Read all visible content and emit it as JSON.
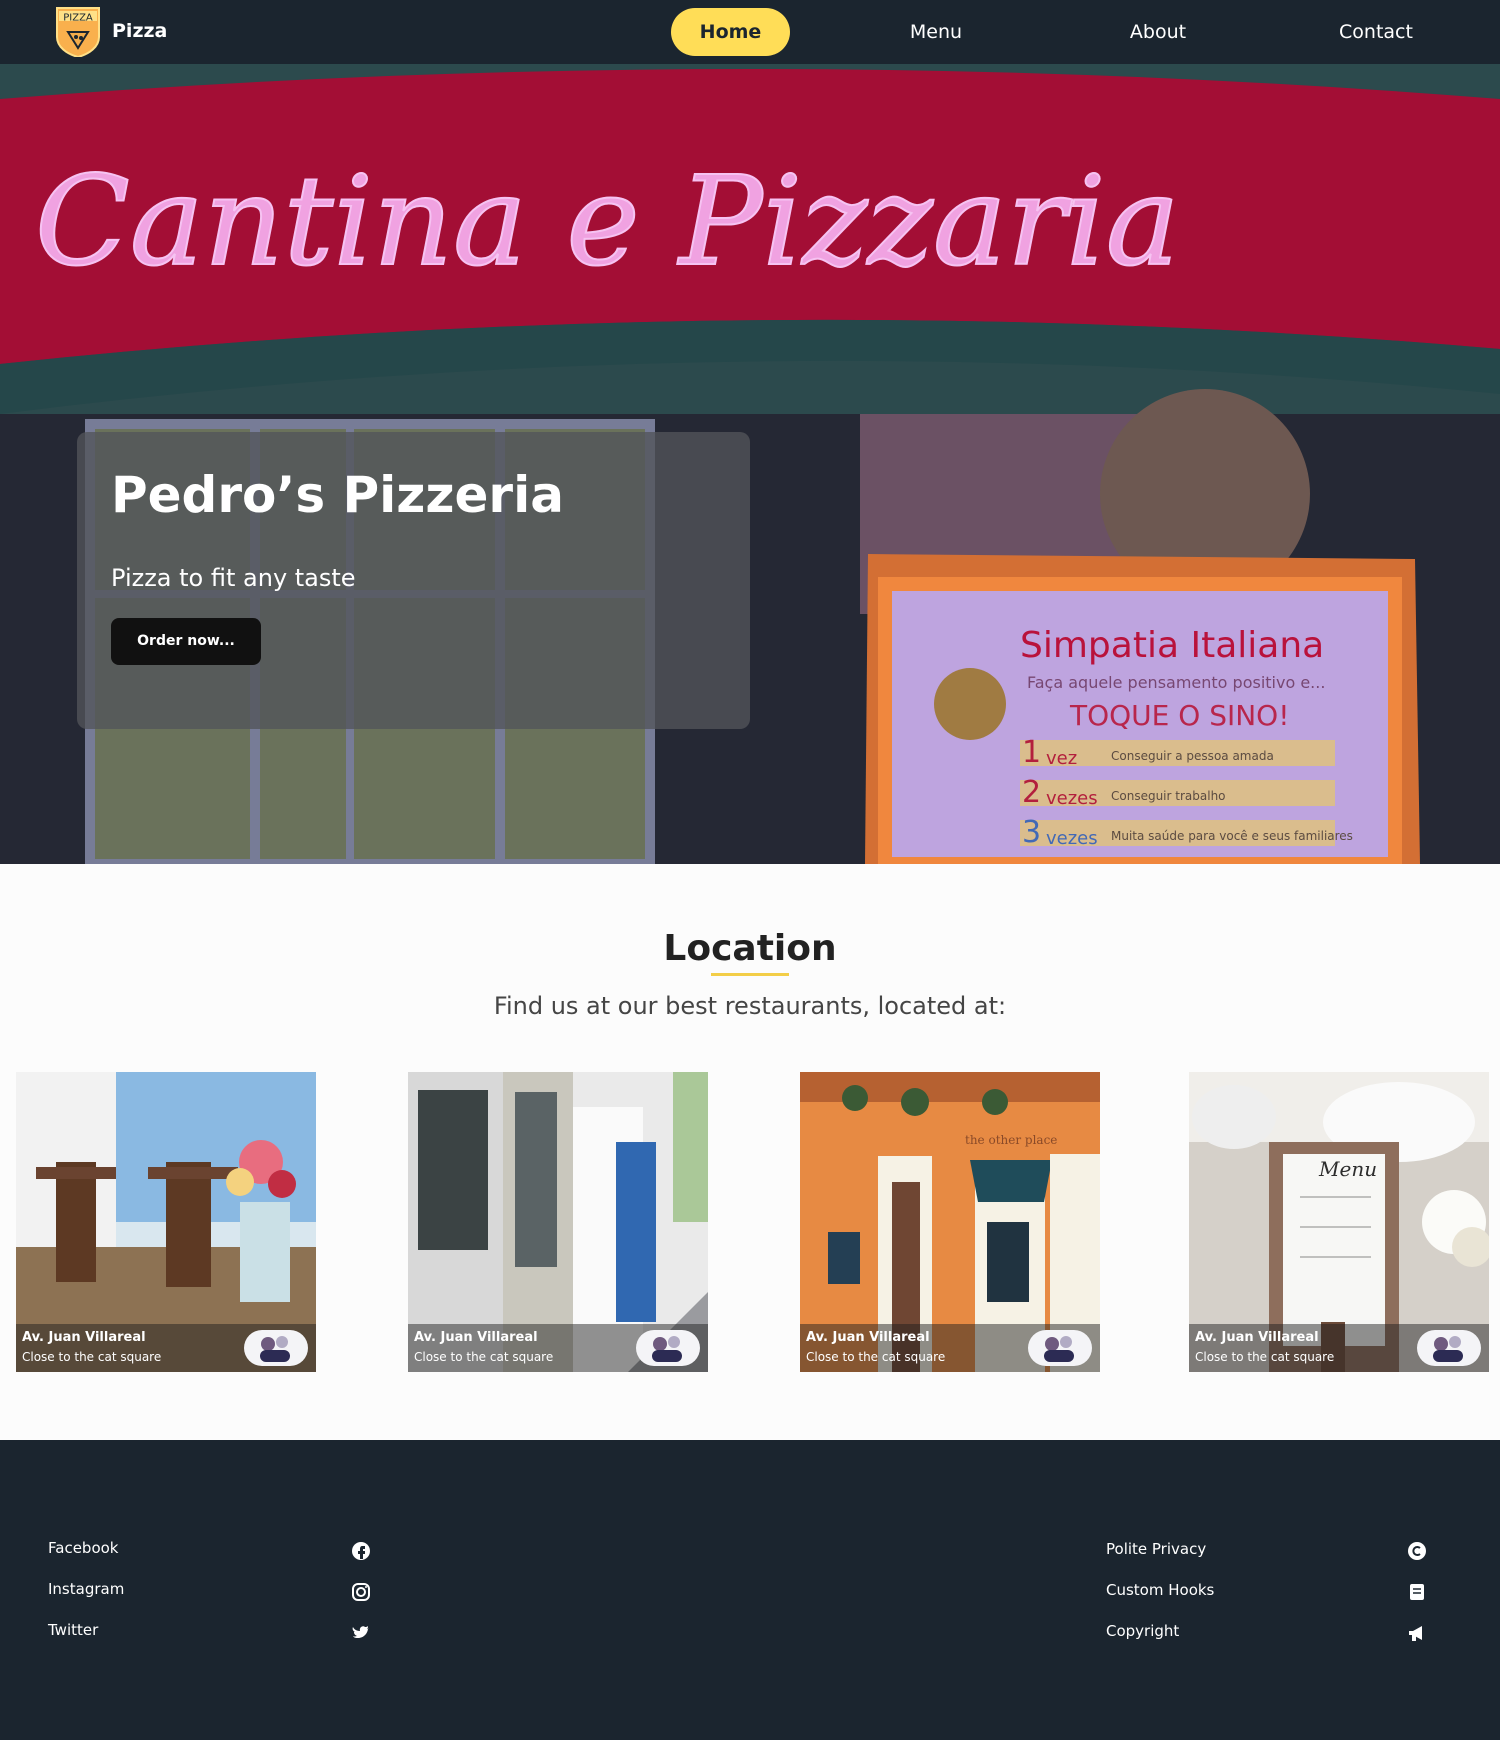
{
  "nav": {
    "brand": "Pizza",
    "logo_text": "PIZZA",
    "items": [
      {
        "label": "Home"
      },
      {
        "label": "Menu"
      },
      {
        "label": "About"
      },
      {
        "label": "Contact"
      }
    ]
  },
  "hero": {
    "sign_text": "Cantina e Pizzaria",
    "board_title": "Simpatia Italiana",
    "board_line": "Faça aquele pensamento positivo e...",
    "board_call": "TOQUE O SINO!",
    "board_rows": [
      {
        "num": "1",
        "word": "vez",
        "text": "Conseguir a pessoa amada"
      },
      {
        "num": "2",
        "word": "vezes",
        "text": "Conseguir trabalho"
      },
      {
        "num": "3",
        "word": "vezes",
        "text": "Muita saúde para você e seus familiares"
      }
    ],
    "title": "Pedro’s Pizzeria",
    "subtitle": "Pizza to fit any taste",
    "cta": "Order now..."
  },
  "location": {
    "title": "Location",
    "subtitle": "Find us at our best restaurants, located at:",
    "cards": [
      {
        "title": "Av. Juan Villareal",
        "subtitle": "Close to the cat square"
      },
      {
        "title": "Av. Juan Villareal",
        "subtitle": "Close to the cat square"
      },
      {
        "title": "Av. Juan Villareal",
        "subtitle": "Close to the cat square",
        "storefront_text": "the other place"
      },
      {
        "title": "Av. Juan Villareal",
        "subtitle": "Close to the cat square",
        "menu_text": "Menu"
      }
    ]
  },
  "footer": {
    "left": [
      {
        "label": "Facebook",
        "icon": "facebook-icon"
      },
      {
        "label": "Instagram",
        "icon": "instagram-icon"
      },
      {
        "label": "Twitter",
        "icon": "twitter-icon"
      }
    ],
    "right": [
      {
        "label": "Polite Privacy",
        "icon": "copyright-icon"
      },
      {
        "label": "Custom Hooks",
        "icon": "book-icon"
      },
      {
        "label": "Copyright",
        "icon": "megaphone-icon"
      }
    ]
  },
  "colors": {
    "nav_bg": "#1b252f",
    "accent": "#ffdd57",
    "footer_bg": "#1b252f"
  }
}
